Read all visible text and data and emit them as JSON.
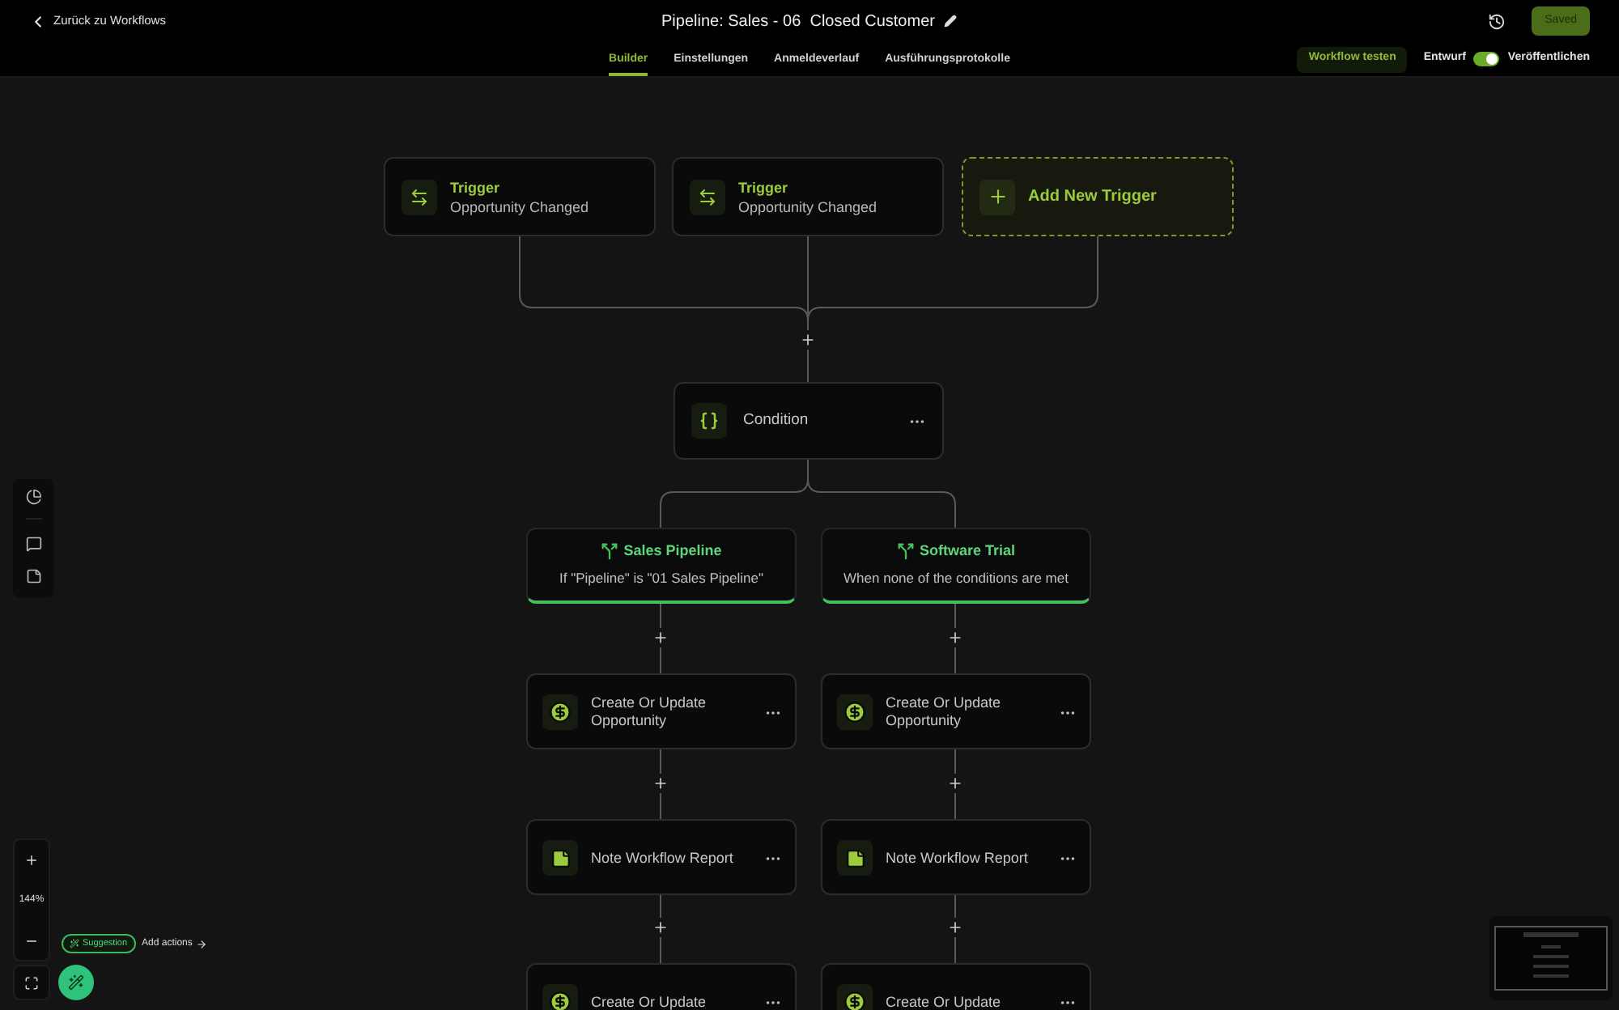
{
  "header": {
    "back_link": "Zurück zu Workflows",
    "title": "Pipeline: Sales - 06  Closed Customer",
    "save_button": "Saved"
  },
  "tabs": [
    {
      "label": "Builder",
      "selected": true
    },
    {
      "label": "Einstellungen",
      "selected": false
    },
    {
      "label": "Anmeldeverlauf",
      "selected": false
    },
    {
      "label": "Ausführungsprotokolle",
      "selected": false
    }
  ],
  "test_button": "Workflow testen",
  "publish_toggle": {
    "off_label": "Entwurf",
    "on_label": "Veröffentlichen",
    "on": true
  },
  "triggers": [
    {
      "kind": "trigger",
      "title": "Trigger",
      "subtitle": "Opportunity Changed"
    },
    {
      "kind": "trigger",
      "title": "Trigger",
      "subtitle": "Opportunity Changed"
    },
    {
      "kind": "add_trigger",
      "title": "Add New Trigger"
    }
  ],
  "condition": {
    "title": "Condition"
  },
  "branches": [
    {
      "title": "Sales Pipeline",
      "subtitle": "If \"Pipeline\" is \"01 Sales Pipeline\"",
      "actions": [
        {
          "kind": "opportunity",
          "title": "Create Or Update Opportunity"
        },
        {
          "kind": "note",
          "title": "Note Workflow Report"
        },
        {
          "kind": "opportunity",
          "title": "Create Or Update"
        }
      ]
    },
    {
      "title": "Software Trial",
      "subtitle": "When none of the conditions are met",
      "actions": [
        {
          "kind": "opportunity",
          "title": "Create Or Update Opportunity"
        },
        {
          "kind": "note",
          "title": "Note Workflow Report"
        },
        {
          "kind": "opportunity",
          "title": "Create Or Update"
        }
      ]
    }
  ],
  "zoom": {
    "level_text": "144%"
  },
  "suggestion": {
    "badge": "Suggestion",
    "link": "Add actions"
  }
}
